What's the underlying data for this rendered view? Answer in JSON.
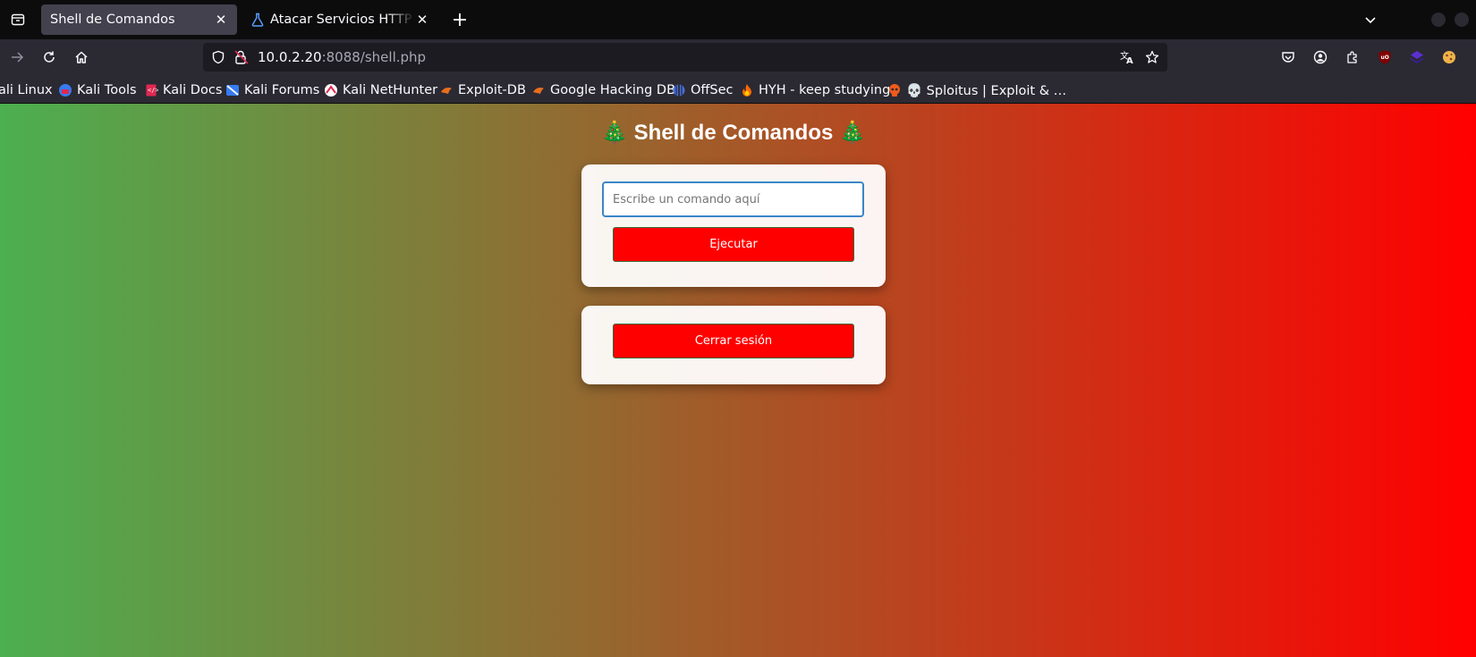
{
  "tabs": [
    {
      "title": "Shell de Comandos",
      "active": true
    },
    {
      "title": "Atacar Servicios HTTP con",
      "active": false
    }
  ],
  "urlbar": {
    "host": "10.0.2.20",
    "rest": ":8088/shell.php"
  },
  "bookmarks": [
    {
      "label": "ali Linux",
      "icon": "kali-icon"
    },
    {
      "label": "Kali Tools",
      "icon": "kali-tools-icon"
    },
    {
      "label": "Kali Docs",
      "icon": "kali-docs-icon"
    },
    {
      "label": "Kali Forums",
      "icon": "kali-forums-icon"
    },
    {
      "label": "Kali NetHunter",
      "icon": "nethunter-icon"
    },
    {
      "label": "Exploit-DB",
      "icon": "exploitdb-icon"
    },
    {
      "label": "Google Hacking DB",
      "icon": "ghdb-icon"
    },
    {
      "label": "OffSec",
      "icon": "offsec-icon"
    },
    {
      "label": "HYH - keep studying",
      "icon": "fire-icon"
    },
    {
      "label": "💀 Sploitus | Exploit & …",
      "icon": "skull-icon"
    }
  ],
  "page": {
    "title": "🎄 Shell de Comandos 🎄",
    "command_placeholder": "Escribe un comando aquí",
    "execute_label": "Ejecutar",
    "logout_label": "Cerrar sesión",
    "gradient_start": "#4caf50",
    "gradient_end": "#ff0000",
    "button_color": "#ff0000"
  }
}
